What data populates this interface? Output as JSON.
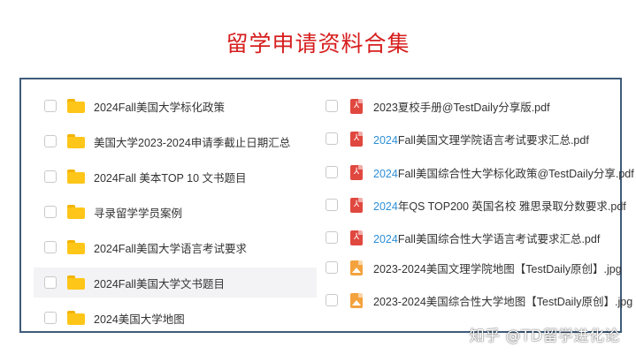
{
  "title": "留学申请资料合集",
  "left_items": [
    {
      "label": "2024Fall美国大学标化政策",
      "icon": "folder-icon"
    },
    {
      "label": "美国大学2023-2024申请季截止日期汇总",
      "icon": "folder-icon"
    },
    {
      "label": "2024Fall 美本TOP 10 文书题目",
      "icon": "folder-icon"
    },
    {
      "label": "寻录留学学员案例",
      "icon": "folder-icon"
    },
    {
      "label": "2024Fall美国大学语言考试要求",
      "icon": "folder-icon"
    },
    {
      "label": "2024Fall美国大学文书题目",
      "icon": "folder-icon",
      "highlighted": true
    },
    {
      "label": "2024美国大学地图",
      "icon": "folder-icon"
    }
  ],
  "right_items": [
    {
      "prefix": "",
      "label": " 2023夏校手册@TestDaily分享版.pdf",
      "icon": "pdf-icon"
    },
    {
      "prefix": "2024",
      "label": "Fall美国文理学院语言考试要求汇总.pdf",
      "icon": "pdf-icon"
    },
    {
      "prefix": "2024",
      "label": "Fall美国综合性大学标化政策@TestDaily分享.pdf",
      "icon": "pdf-icon"
    },
    {
      "prefix": "2024",
      "label": "年QS TOP200 英国名校 雅思录取分数要求.pdf",
      "icon": "pdf-icon"
    },
    {
      "prefix": "2024",
      "label": "Fall美国综合性大学语言考试要求汇总.pdf",
      "icon": "pdf-icon"
    },
    {
      "prefix": "",
      "label": "2023-2024美国文理学院地图【TestDaily原创】.jpg",
      "icon": "image-icon"
    },
    {
      "prefix": "",
      "label": "2023-2024美国综合性大学地图【TestDaily原创】.jpg",
      "icon": "image-icon"
    }
  ],
  "watermark": "知乎 @TD留学进化论",
  "colors": {
    "title": "#d71e1e",
    "year_highlight": "#2e8fd6",
    "border": "#3f5b7a",
    "folder": "#ffc61a",
    "pdf": "#e0483f",
    "image": "#f3a23d"
  }
}
